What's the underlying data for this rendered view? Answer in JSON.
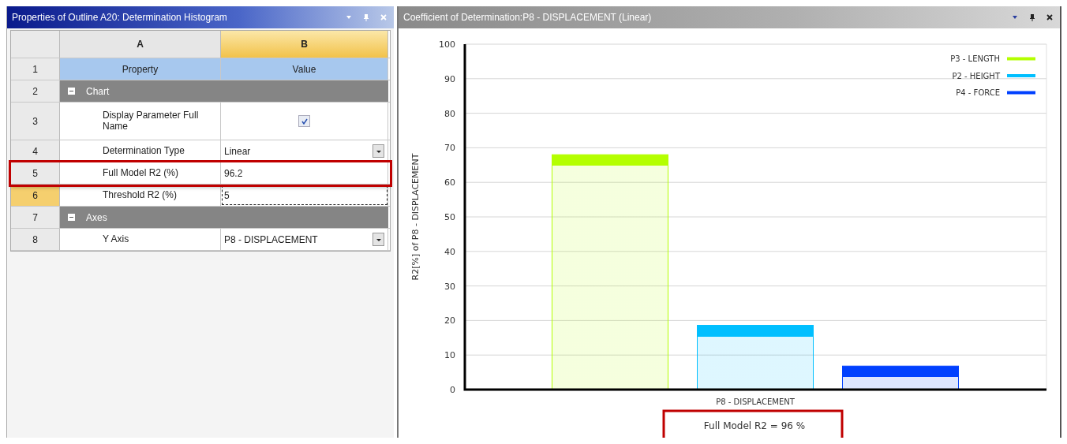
{
  "properties_panel": {
    "title": "Properties of Outline A20: Determination Histogram",
    "columns": [
      {
        "label": "A",
        "selected": false
      },
      {
        "label": "B",
        "selected": true
      }
    ],
    "rows": [
      {
        "number": "1",
        "kind": "header",
        "property": "Property",
        "value": "Value",
        "selected": false,
        "highlighted": false
      },
      {
        "number": "2",
        "kind": "group",
        "label": "Chart",
        "expanded": true,
        "selected": false,
        "highlighted": false
      },
      {
        "number": "3",
        "kind": "checkbox",
        "property": "Display Parameter Full Name",
        "checked": true,
        "selected": false,
        "highlighted": false
      },
      {
        "number": "4",
        "kind": "dropdown",
        "property": "Determination Type",
        "value": "Linear",
        "selected": false,
        "highlighted": false
      },
      {
        "number": "5",
        "kind": "text",
        "property": "Full Model R2 (%)",
        "value": "96.2",
        "selected": false,
        "highlighted": true
      },
      {
        "number": "6",
        "kind": "text",
        "property": "Threshold R2 (%)",
        "value": "5",
        "selected": true,
        "highlighted": false
      },
      {
        "number": "7",
        "kind": "group",
        "label": "Axes",
        "expanded": true,
        "selected": false,
        "highlighted": false
      },
      {
        "number": "8",
        "kind": "dropdown",
        "property": "Y Axis",
        "value": "P8 - DISPLACEMENT",
        "selected": false,
        "highlighted": false
      }
    ]
  },
  "chart_panel": {
    "title": "Coefficient of Determination:P8 - DISPLACEMENT (Linear)",
    "chart_data": {
      "type": "bar",
      "ylabel": "R2[%] of P8 - DISPLACEMENT",
      "categories": [
        "P8 - DISPLACEMENT"
      ],
      "series": [
        {
          "name": "P3 - LENGTH",
          "color": "#b4ff00",
          "values": [
            68
          ]
        },
        {
          "name": "P2 - HEIGHT",
          "color": "#00bfff",
          "values": [
            18.6
          ]
        },
        {
          "name": "P4 - FORCE",
          "color": "#0040ff",
          "values": [
            6.8
          ]
        }
      ],
      "grid": true,
      "legend": true,
      "ylim": [
        0,
        100
      ],
      "yticks": [
        0,
        10,
        20,
        30,
        40,
        50,
        60,
        70,
        80,
        90,
        100
      ]
    },
    "footer": {
      "text": "Full Model R2 = 96 %",
      "highlighted": true
    }
  }
}
